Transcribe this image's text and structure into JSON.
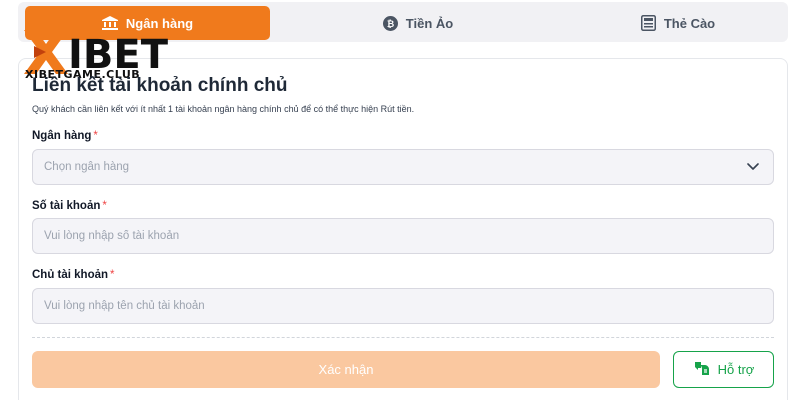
{
  "tabs": [
    {
      "label": "Ngân hàng",
      "icon": "bank-icon",
      "active": true
    },
    {
      "label": "Tiền Ảo",
      "icon": "bitcoin-icon",
      "active": false
    },
    {
      "label": "Thẻ Cào",
      "icon": "scratch-card-icon",
      "active": false
    }
  ],
  "logo": {
    "text": "IBET",
    "site": "XIBETGAME.CLUB"
  },
  "form": {
    "title": "Liên kết tài khoản chính chủ",
    "subtitle": "Quý khách cần liên kết với ít nhất 1 tài khoản ngân hàng chính chủ để có thể thực hiện Rút tiền.",
    "bank": {
      "label": "Ngân hàng",
      "placeholder": "Chọn ngân hàng",
      "required_mark": "*"
    },
    "account_number": {
      "label": "Số tài khoản",
      "placeholder": "Vui lòng nhập số tài khoản",
      "required_mark": "*"
    },
    "account_holder": {
      "label": "Chủ tài khoản",
      "placeholder": "Vui lòng nhập tên chủ tài khoản",
      "required_mark": "*"
    },
    "confirm_label": "Xác nhận",
    "help_label": "Hỗ trợ"
  },
  "colors": {
    "accent": "#f07a1c",
    "confirm_disabled": "#fac8a0",
    "help_green": "#16a34a",
    "required": "#ef4444"
  }
}
